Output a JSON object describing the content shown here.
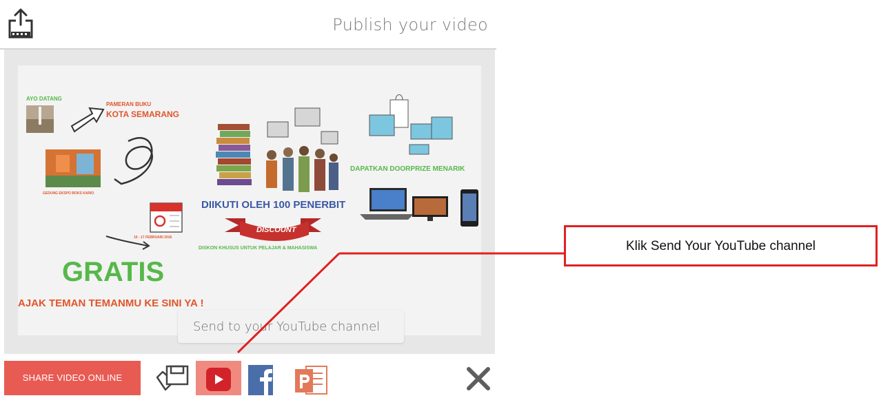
{
  "header": {
    "title": "Publish your video",
    "upload_icon": "upload-icon"
  },
  "preview": {
    "labels": {
      "ayo_datang": "AYO DATANG",
      "pameran": "PAMERAN BUKU",
      "kota": "KOTA SEMARANG",
      "building_caption": "GEDUNG EKSPO BOKS KARIO",
      "date": "10 - 17 FEBRUARI 2016",
      "diikuti": "DIIKUTI OLEH 100 PENERBIT",
      "discount": "DISCOUNT",
      "diskon": "DISKON KHUSUS UNTUK PELAJAR & MAHASISWA",
      "doorprize": "DAPATKAN DOORPRIZE MENARIK",
      "gratis": "GRATIS",
      "ajak": "AJAK TEMAN TEMANMU KE SINI YA !"
    }
  },
  "tooltip": {
    "text": "Send to your YouTube channel"
  },
  "toolbar": {
    "share_label": "SHARE VIDEO ONLINE",
    "icons": [
      "save-video-icon",
      "youtube-icon",
      "facebook-icon",
      "powerpoint-icon",
      "close-icon"
    ]
  },
  "callout": {
    "text": "Klik Send Your YouTube channel"
  },
  "colors": {
    "accent_red": "#e85b53",
    "youtube_red": "#d2232a",
    "facebook_blue": "#4a6ea9",
    "ppt_orange": "#e27a5a",
    "annotation_red": "#e02020",
    "green": "#56b84a"
  }
}
